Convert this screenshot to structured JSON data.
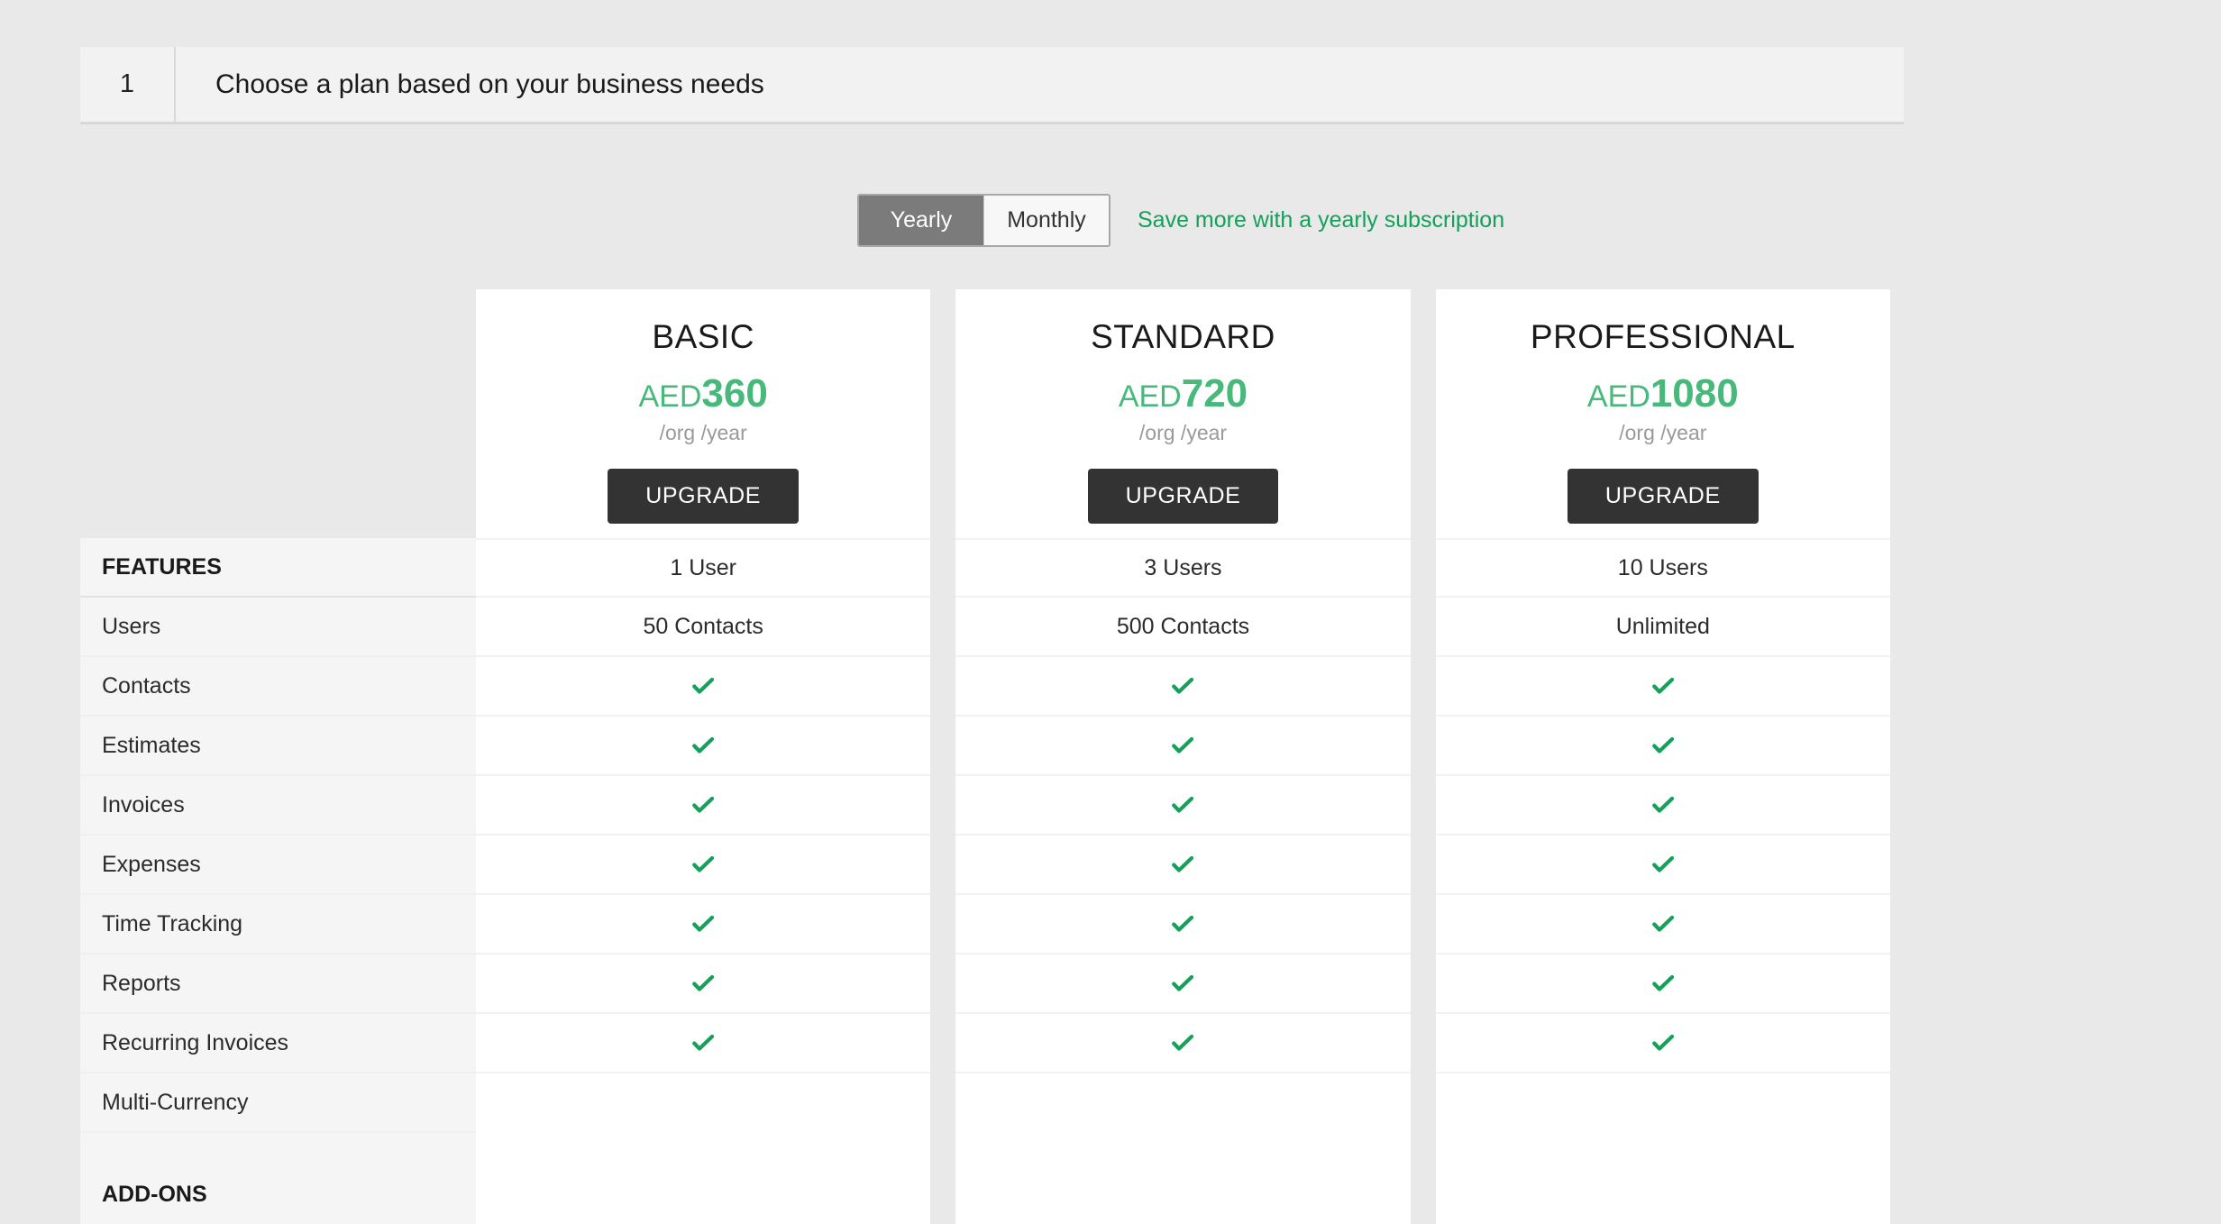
{
  "step": {
    "number": "1",
    "title": "Choose a plan based on your business needs"
  },
  "billing": {
    "options": [
      {
        "label": "Yearly",
        "selected": true
      },
      {
        "label": "Monthly",
        "selected": false
      }
    ],
    "note": "Save more with a yearly subscription"
  },
  "colors": {
    "price_green": "#46b97b",
    "note_green": "#12a05a",
    "check_green": "#17a05a",
    "button_dark": "#333333",
    "page_background": "#e9e9e9",
    "sidebar_background": "#f5f5f5"
  },
  "comparison": {
    "features_header": "FEATURES",
    "addons_header": "ADD-ONS",
    "feature_labels": [
      "Users",
      "Contacts",
      "Estimates",
      "Invoices",
      "Expenses",
      "Time Tracking",
      "Reports",
      "Recurring Invoices",
      "Multi-Currency"
    ]
  },
  "plans": [
    {
      "name": "BASIC",
      "currency": "AED",
      "amount": "360",
      "period": "/org /year",
      "cta": "UPGRADE",
      "values": [
        {
          "type": "text",
          "text": "1 User"
        },
        {
          "type": "text",
          "text": "50 Contacts"
        },
        {
          "type": "check",
          "text": ""
        },
        {
          "type": "check",
          "text": ""
        },
        {
          "type": "check",
          "text": ""
        },
        {
          "type": "check",
          "text": ""
        },
        {
          "type": "check",
          "text": ""
        },
        {
          "type": "check",
          "text": ""
        },
        {
          "type": "check",
          "text": ""
        }
      ]
    },
    {
      "name": "STANDARD",
      "currency": "AED",
      "amount": "720",
      "period": "/org /year",
      "cta": "UPGRADE",
      "values": [
        {
          "type": "text",
          "text": "3 Users"
        },
        {
          "type": "text",
          "text": "500 Contacts"
        },
        {
          "type": "check",
          "text": ""
        },
        {
          "type": "check",
          "text": ""
        },
        {
          "type": "check",
          "text": ""
        },
        {
          "type": "check",
          "text": ""
        },
        {
          "type": "check",
          "text": ""
        },
        {
          "type": "check",
          "text": ""
        },
        {
          "type": "check",
          "text": ""
        }
      ]
    },
    {
      "name": "PROFESSIONAL",
      "currency": "AED",
      "amount": "1080",
      "period": "/org /year",
      "cta": "UPGRADE",
      "values": [
        {
          "type": "text",
          "text": "10 Users"
        },
        {
          "type": "text",
          "text": "Unlimited"
        },
        {
          "type": "check",
          "text": ""
        },
        {
          "type": "check",
          "text": ""
        },
        {
          "type": "check",
          "text": ""
        },
        {
          "type": "check",
          "text": ""
        },
        {
          "type": "check",
          "text": ""
        },
        {
          "type": "check",
          "text": ""
        },
        {
          "type": "check",
          "text": ""
        }
      ]
    }
  ]
}
